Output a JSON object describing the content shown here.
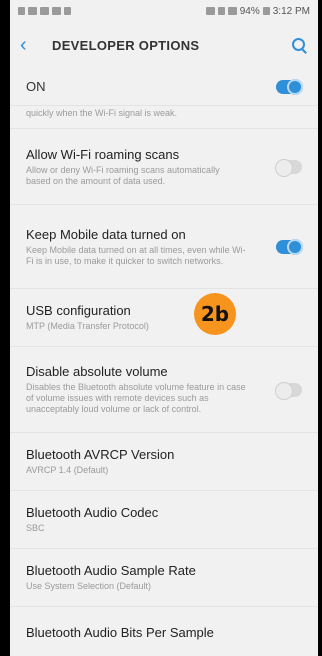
{
  "status_bar": {
    "time": "3:12 PM",
    "battery": "94%"
  },
  "app_bar": {
    "back_icon": "chevron-left-icon",
    "title": "DEVELOPER OPTIONS",
    "search_icon": "search-icon",
    "accent": "#2f8fd8"
  },
  "master": {
    "label": "ON",
    "state": true
  },
  "partial_text": "quickly when the Wi-Fi signal is weak.",
  "settings": [
    {
      "title": "Allow Wi-Fi roaming scans",
      "subtitle": "Allow or deny Wi-Fi roaming scans automatically based on the amount of data used.",
      "toggle": "off"
    },
    {
      "title": "Keep Mobile data turned on",
      "subtitle": "Keep Mobile data turned on at all times, even while Wi-Fi is in use, to make it quicker to switch networks.",
      "toggle": "on"
    },
    {
      "title": "USB configuration",
      "subtitle": "MTP (Media Transfer Protocol)",
      "toggle": "none",
      "badge": "2b"
    },
    {
      "title": "Disable absolute volume",
      "subtitle": "Disables the Bluetooth absolute volume feature in case of volume issues with remote devices such as unacceptably loud volume or lack of control.",
      "toggle": "off"
    },
    {
      "title": "Bluetooth AVRCP Version",
      "subtitle": "AVRCP 1.4 (Default)",
      "toggle": "none"
    },
    {
      "title": "Bluetooth Audio Codec",
      "subtitle": "SBC",
      "toggle": "none"
    },
    {
      "title": "Bluetooth Audio Sample Rate",
      "subtitle": "Use System Selection (Default)",
      "toggle": "none"
    },
    {
      "title": "Bluetooth Audio Bits Per Sample",
      "subtitle": "",
      "toggle": "none"
    }
  ],
  "badge_color": "#f7941d"
}
